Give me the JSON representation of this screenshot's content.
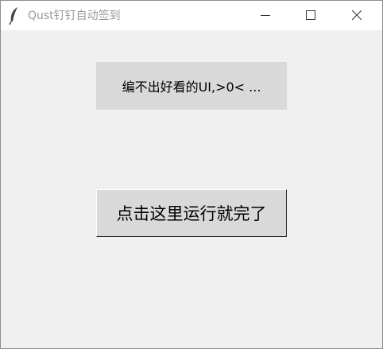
{
  "window": {
    "title": "Qust钉钉自动签到",
    "icons": {
      "app": "feather-icon",
      "minimize": "minimize-icon",
      "maximize": "maximize-icon",
      "close": "close-icon"
    }
  },
  "main": {
    "label_text": "编不出好看的UI,>0< ...",
    "run_button_label": "点击这里运行就完了"
  },
  "colors": {
    "window_bg": "#f0f0f0",
    "titlebar_bg": "#ffffff",
    "title_text": "#9a9a9a",
    "widget_bg": "#d9d9d9"
  }
}
